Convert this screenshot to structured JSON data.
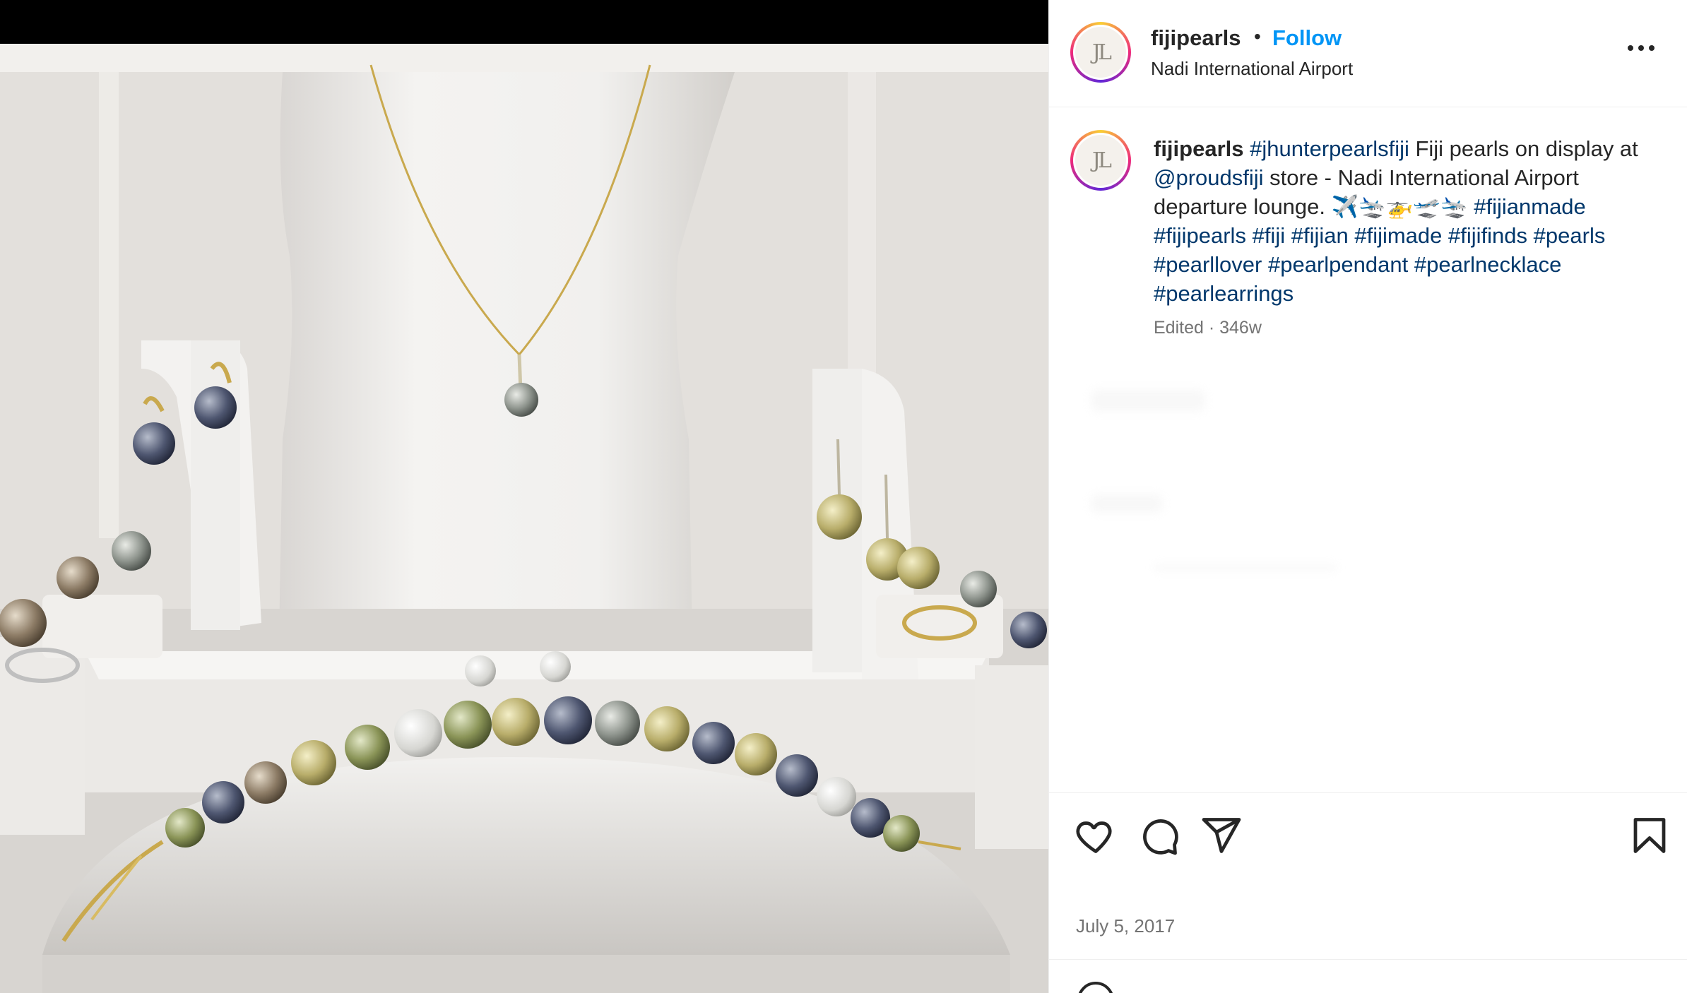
{
  "post": {
    "author": "fijipearls",
    "follow_label": "Follow",
    "separator": "•",
    "location": "Nadi International Airport",
    "avatar_text": "JL",
    "caption": {
      "username": "fijipearls",
      "segments": [
        {
          "type": "tag",
          "text": "#jhunterpearlsfiji"
        },
        {
          "type": "text",
          "text": " Fiji pearls on display at "
        },
        {
          "type": "mention",
          "text": "@proudsfiji"
        },
        {
          "type": "text",
          "text": " store - Nadi International Airport departure lounge. ✈️🛬🚁🛫🛬 "
        },
        {
          "type": "tag",
          "text": "#fijianmade"
        },
        {
          "type": "text",
          "text": " "
        },
        {
          "type": "tag",
          "text": "#fijipearls"
        },
        {
          "type": "text",
          "text": " "
        },
        {
          "type": "tag",
          "text": "#fiji"
        },
        {
          "type": "text",
          "text": " "
        },
        {
          "type": "tag",
          "text": "#fijian"
        },
        {
          "type": "text",
          "text": " "
        },
        {
          "type": "tag",
          "text": "#fijimade"
        },
        {
          "type": "text",
          "text": " "
        },
        {
          "type": "tag",
          "text": "#fijifinds"
        },
        {
          "type": "text",
          "text": " "
        },
        {
          "type": "tag",
          "text": "#pearls"
        },
        {
          "type": "text",
          "text": " "
        },
        {
          "type": "tag",
          "text": "#pearllover"
        },
        {
          "type": "text",
          "text": " "
        },
        {
          "type": "tag",
          "text": "#pearlpendant"
        },
        {
          "type": "text",
          "text": " "
        },
        {
          "type": "tag",
          "text": "#pearlnecklace"
        },
        {
          "type": "text",
          "text": " "
        },
        {
          "type": "tag",
          "text": "#pearlearrings"
        }
      ],
      "meta": "Edited · 346w"
    },
    "date": "July 5, 2017"
  },
  "icons": {
    "more": "more-options-icon",
    "like": "heart-icon",
    "comment": "comment-icon",
    "share": "share-icon",
    "save": "bookmark-icon"
  },
  "colors": {
    "link": "#0095f6",
    "hashtag": "#00376b",
    "secondary": "#737373",
    "divider": "#efefef"
  }
}
